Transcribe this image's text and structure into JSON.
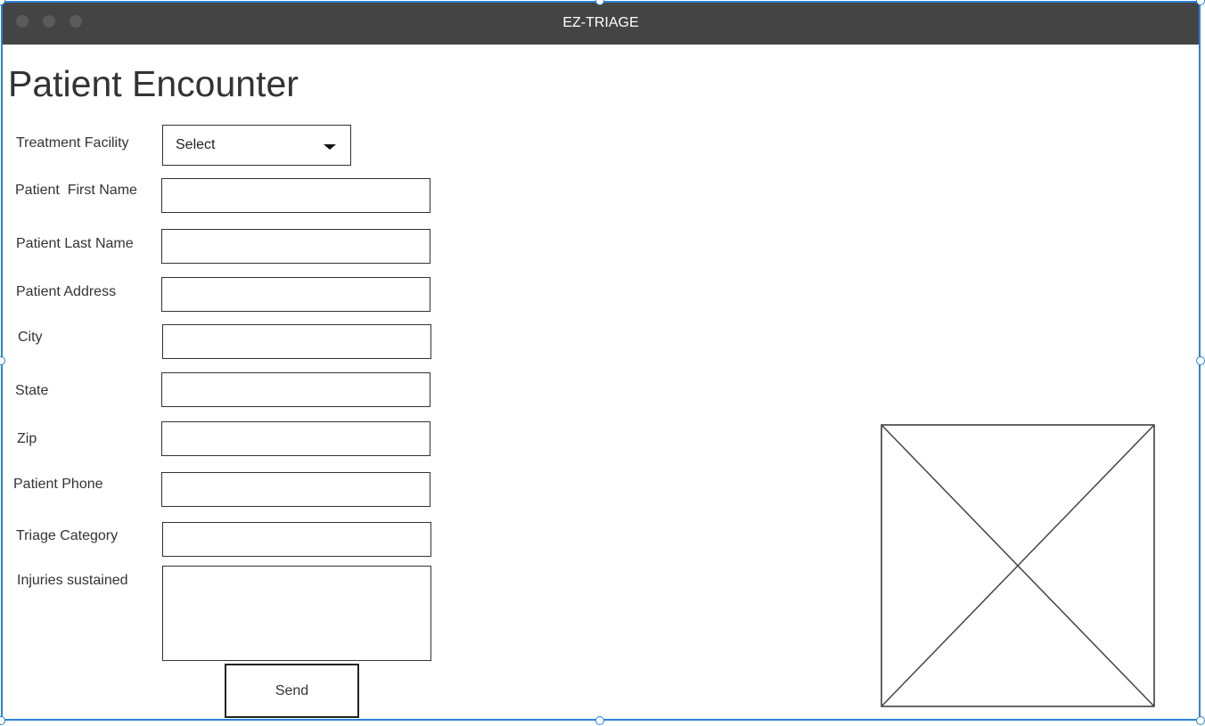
{
  "window": {
    "title": "EZ-TRIAGE"
  },
  "page": {
    "title": "Patient Encounter"
  },
  "form": {
    "treatment_facility": {
      "label": "Treatment Facility",
      "selected": "Select"
    },
    "first_name": {
      "label": "Patient  First Name",
      "value": ""
    },
    "last_name": {
      "label": "Patient Last Name",
      "value": ""
    },
    "address": {
      "label": "Patient Address",
      "value": ""
    },
    "city": {
      "label": "City",
      "value": ""
    },
    "state": {
      "label": "State",
      "value": ""
    },
    "zip": {
      "label": "Zip",
      "value": ""
    },
    "phone": {
      "label": "Patient Phone",
      "value": ""
    },
    "triage_category": {
      "label": "Triage Category",
      "value": ""
    },
    "injuries": {
      "label": "Injuries sustained",
      "value": ""
    },
    "send_label": "Send"
  },
  "icons": {
    "window_controls": [
      "close-icon",
      "minimize-icon",
      "maximize-icon"
    ],
    "dropdown": "chevron-down-icon",
    "image": "image-placeholder-icon"
  },
  "colors": {
    "titlebar": "#444444",
    "selection_border": "#2b82d9",
    "text": "#333333"
  }
}
